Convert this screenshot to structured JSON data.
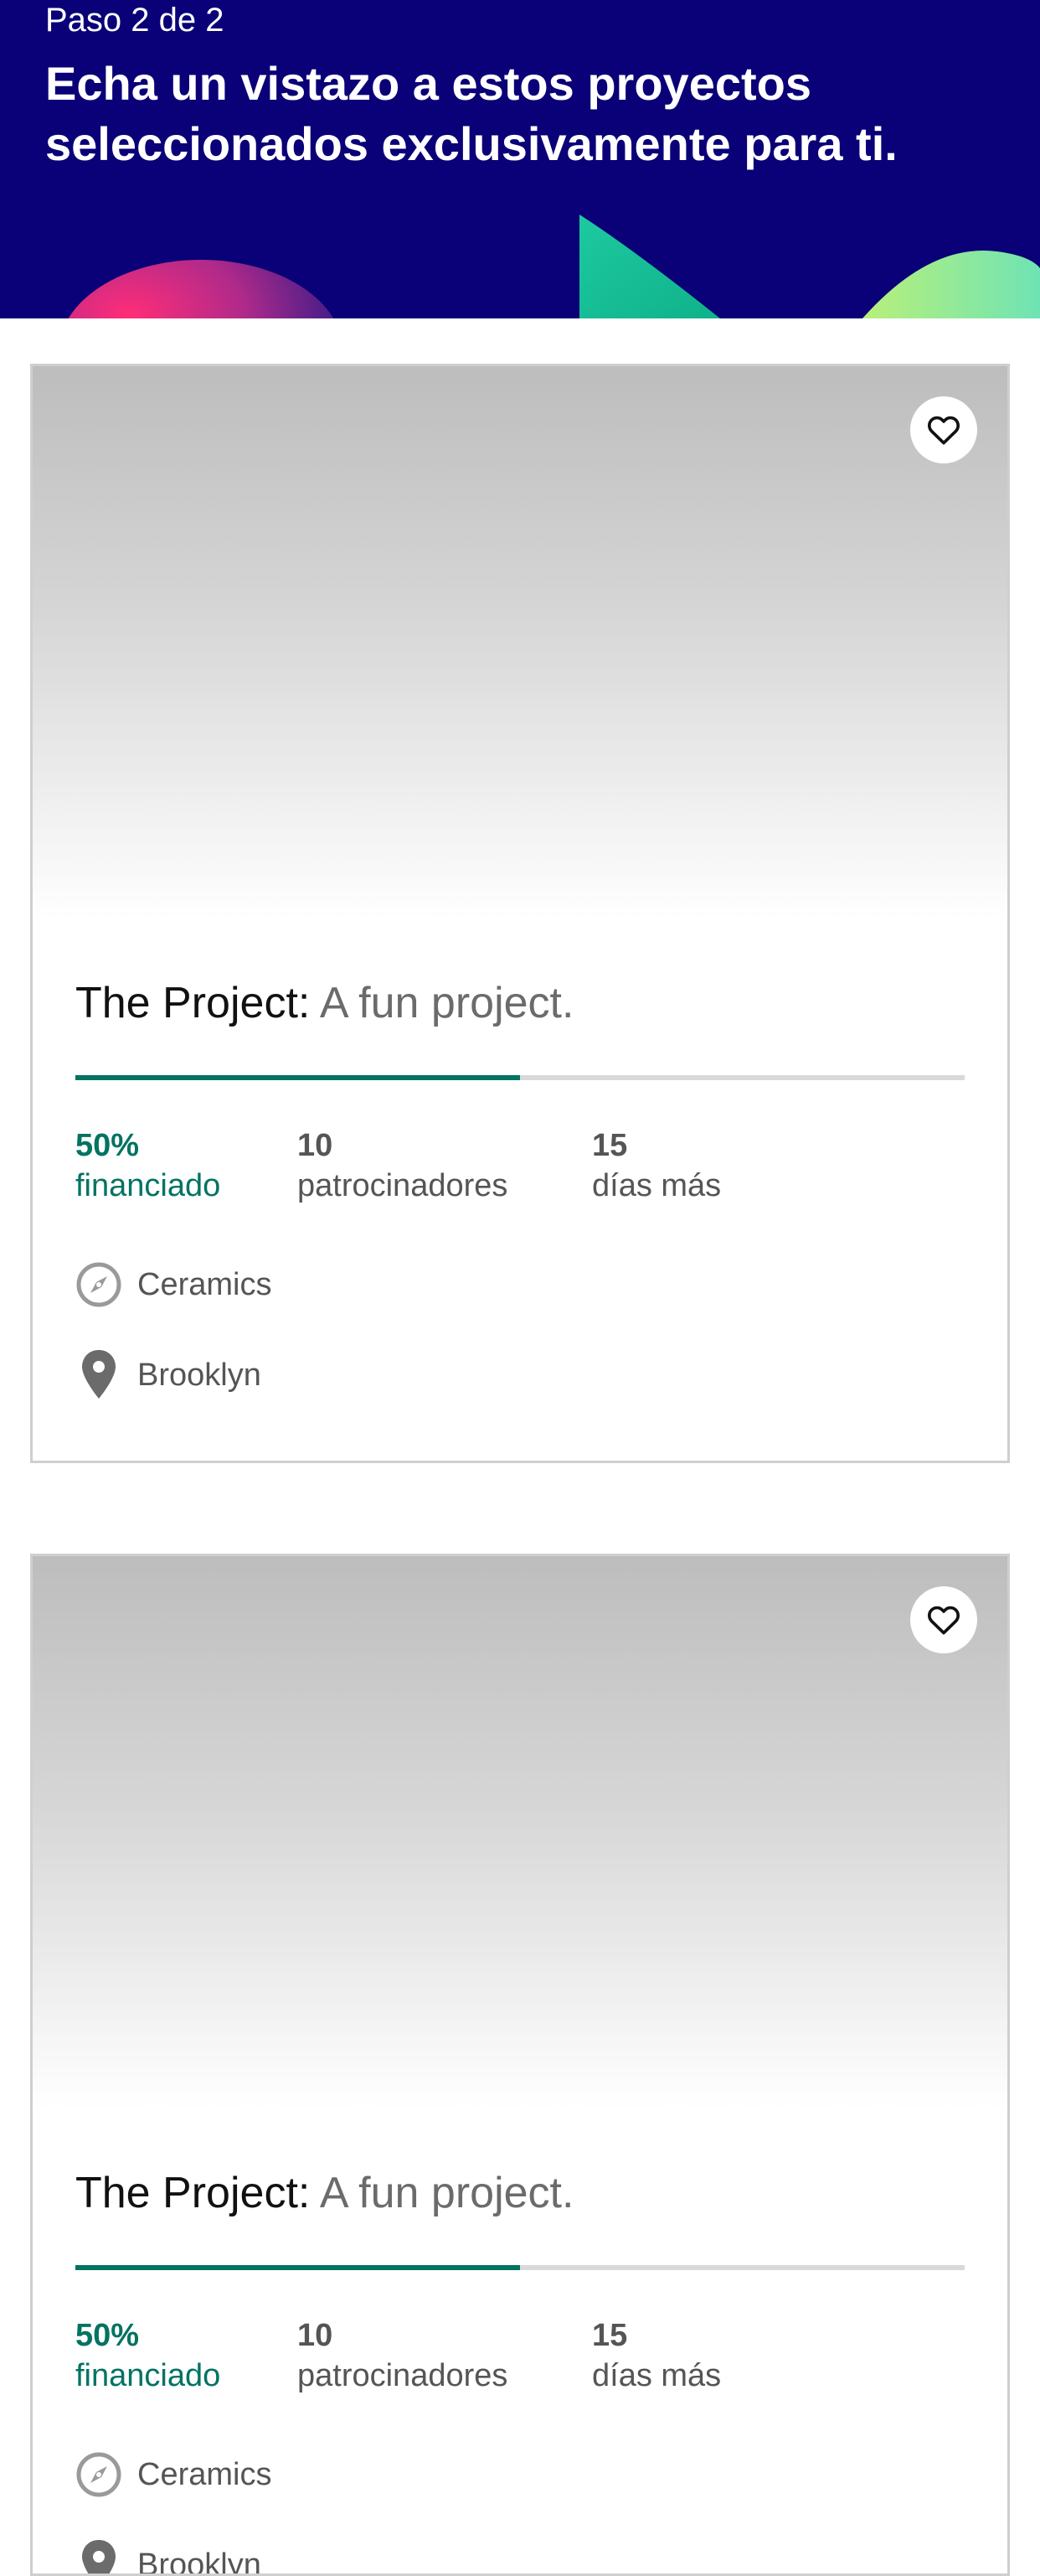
{
  "header": {
    "step": "Paso 2 de 2",
    "title": "Echa un vistazo a estos proyectos seleccionados exclusivamente para ti."
  },
  "colors": {
    "header_bg": "#0a0077",
    "funded_green": "#037362",
    "progress_track": "#d9d9d9"
  },
  "projects": [
    {
      "name": "The Project:",
      "blurb": "A fun project.",
      "funded_percent": 50,
      "funded_value": "50%",
      "funded_label": "financiado",
      "backers_value": "10",
      "backers_label": "patrocinadores",
      "days_value": "15",
      "days_label": "días más",
      "category": "Ceramics",
      "location": "Brooklyn",
      "favorite_icon": "heart-icon"
    },
    {
      "name": "The Project:",
      "blurb": "A fun project.",
      "funded_percent": 50,
      "funded_value": "50%",
      "funded_label": "financiado",
      "backers_value": "10",
      "backers_label": "patrocinadores",
      "days_value": "15",
      "days_label": "días más",
      "category": "Ceramics",
      "location": "Brooklyn",
      "favorite_icon": "heart-icon"
    }
  ]
}
